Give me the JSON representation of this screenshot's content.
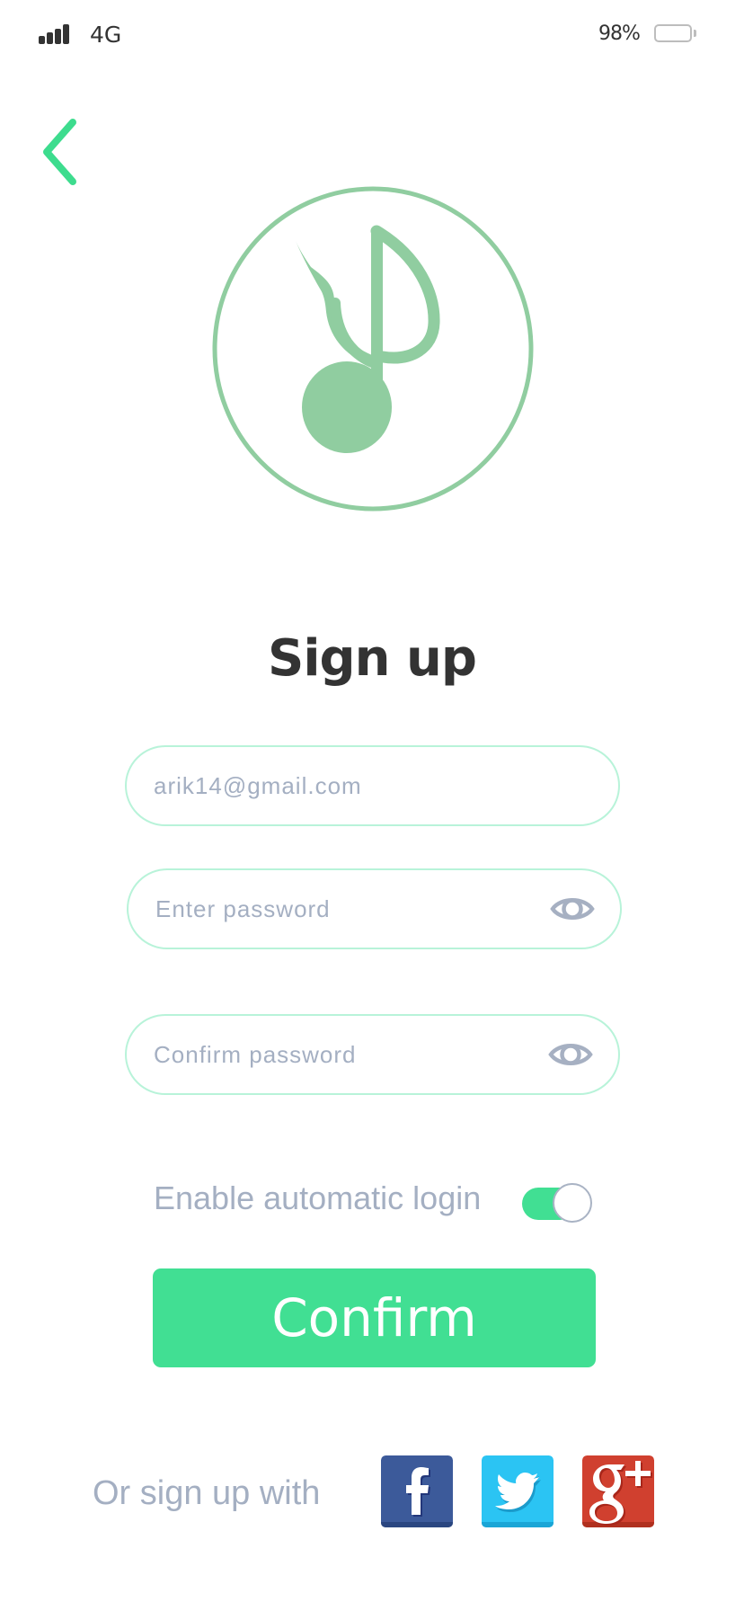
{
  "status_bar": {
    "network": "4G",
    "battery_percent": "98%",
    "signal_icon": "signal-bars-icon",
    "battery_icon": "battery-icon"
  },
  "nav": {
    "back_icon": "chevron-left-icon"
  },
  "logo": {
    "icon": "music-note-icon",
    "color": "#90CDA0"
  },
  "title": "Sign up",
  "form": {
    "email": {
      "value": "arik14@gmail.com",
      "placeholder": ""
    },
    "password": {
      "value": "",
      "placeholder": "Enter password",
      "icon": "eye-icon"
    },
    "confirm_password": {
      "value": "",
      "placeholder": "Confirm password",
      "icon": "eye-icon"
    }
  },
  "auto_login": {
    "label": "Enable automatic login",
    "enabled": true
  },
  "confirm_button": "Confirm",
  "social": {
    "label": "Or sign up with",
    "providers": [
      {
        "name": "Facebook",
        "icon": "facebook-icon",
        "color": "#3C5A9A"
      },
      {
        "name": "Twitter",
        "icon": "twitter-icon",
        "color": "#2BC4F3"
      },
      {
        "name": "Google+",
        "icon": "google-plus-icon",
        "color": "#D0402F"
      }
    ]
  },
  "colors": {
    "accent": "#41DF93",
    "field_border": "#B8F3D9",
    "muted_text": "#A4AFC2",
    "title_text": "#333333"
  }
}
